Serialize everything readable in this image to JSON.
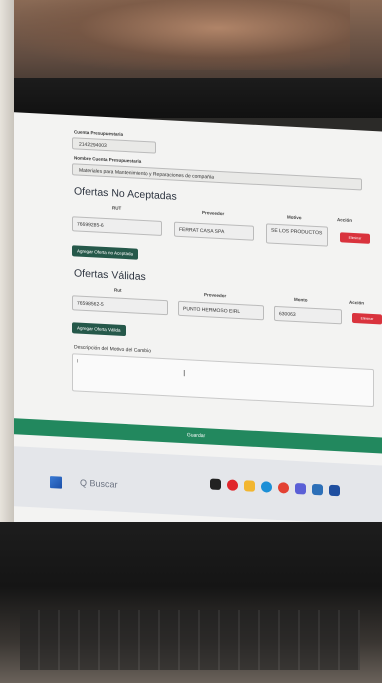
{
  "form": {
    "cuenta_label": "Cuenta Presupuestaria",
    "cuenta_value": "2142294003",
    "cuenta_nombre_label": "Nombre Cuenta Presupuestaria",
    "cuenta_nombre_value": "Materiales para Mantenimiento y Reparaciones de compañía"
  },
  "ofertas_no_aceptadas": {
    "title": "Ofertas No Aceptadas",
    "columns": [
      "RUT",
      "Proveedor",
      "Motivo",
      "Acción"
    ],
    "rows": [
      {
        "rut": "76699285-6",
        "proveedor": "FERRAT CASA SPA",
        "motivo": "SE LOS PRODUCTOS",
        "action": "Eliminar"
      }
    ],
    "add_button": "Agregar Oferta no Aceptada"
  },
  "ofertas_validas": {
    "title": "Ofertas Válidas",
    "columns": [
      "Rut",
      "Proveedor",
      "Monto",
      "Acción"
    ],
    "rows": [
      {
        "rut": "76598562-5",
        "proveedor": "PUNTO HERMOSO EIRL",
        "monto": "630063",
        "action": "Eliminar"
      }
    ],
    "add_button": "Agregar Oferta Válida"
  },
  "descripcion": {
    "label": "Descripción del Motivo del Cambio",
    "value": "I"
  },
  "save_button": "Guardar",
  "taskbar": {
    "search_text": "Q Buscar",
    "icons": [
      "start-icon",
      "search-icon",
      "task-view-icon",
      "opera-icon",
      "file-explorer-icon",
      "edge-icon",
      "chrome-icon",
      "teams-icon",
      "app-icon",
      "app-icon-2"
    ]
  }
}
